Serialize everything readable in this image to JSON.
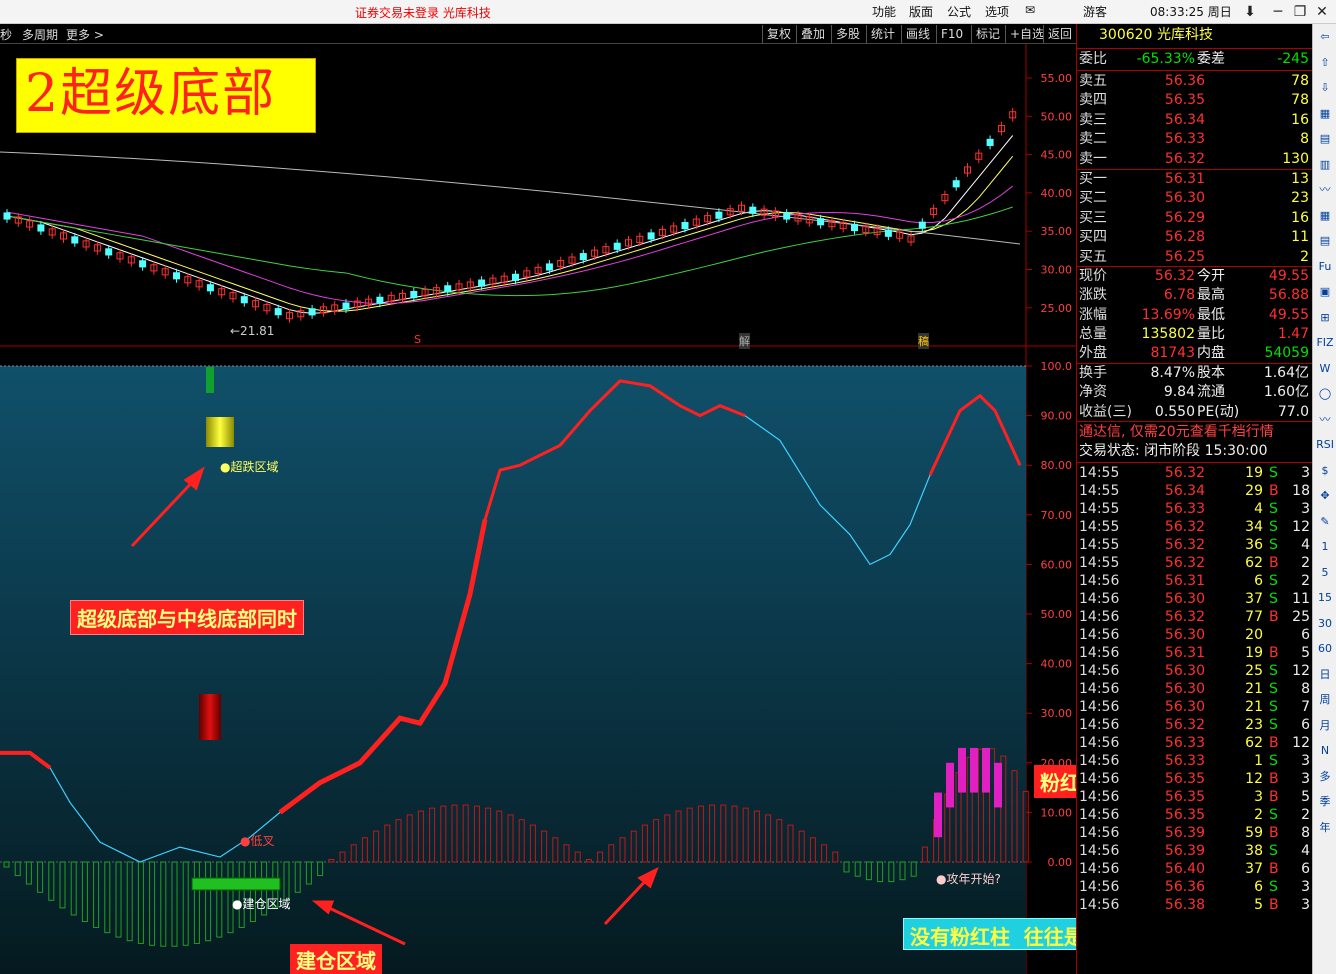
{
  "titlebar": {
    "notice": "证券交易未登录  光库科技",
    "menus": [
      "功能",
      "版面",
      "公式",
      "选项"
    ],
    "user": "游客",
    "time": "08:33:25 周日",
    "win_buttons": [
      "⬇",
      "─",
      "❐",
      "✕"
    ]
  },
  "toolbar": {
    "left_items": [
      "秒",
      "多周期",
      "更多 >"
    ],
    "buttons": [
      "复权",
      "叠加",
      "多股",
      "统计",
      "画线",
      "F10",
      "标记",
      "+自选",
      "返回"
    ]
  },
  "chart_labels": {
    "title_box": "2超级底部",
    "low_price": "←21.81",
    "marker_s": "S",
    "marker_jie": "解",
    "marker_qin": "稿",
    "super_fall_zone": "●超跌区域",
    "bottom_note": "超级底部与中线底部同时",
    "low_cross": "●低叉",
    "build_zone": "●建仓区域",
    "build_zone_big": "建仓区域",
    "pink_note": "粉红柱是攻年线的能量柱",
    "attack_start": "●攻年开始?",
    "no_pink": "没有粉红柱  往往是攻年失败的!"
  },
  "upper_axis": [
    "55.00",
    "50.00",
    "45.00",
    "40.00",
    "35.00",
    "30.00",
    "25.00"
  ],
  "lower_axis": [
    "100.0",
    "90.00",
    "80.00",
    "70.00",
    "60.00",
    "50.00",
    "40.00",
    "30.00",
    "20.00",
    "10.00",
    "0.00"
  ],
  "quote": {
    "code": "300620",
    "name": "光库科技",
    "weibi_label": "委比",
    "weibi": "-65.33%",
    "weicha_label": "委差",
    "weicha": "-245",
    "asks": [
      {
        "l": "卖五",
        "p": "56.36",
        "v": "78"
      },
      {
        "l": "卖四",
        "p": "56.35",
        "v": "78"
      },
      {
        "l": "卖三",
        "p": "56.34",
        "v": "16"
      },
      {
        "l": "卖二",
        "p": "56.33",
        "v": "8"
      },
      {
        "l": "卖一",
        "p": "56.32",
        "v": "130"
      }
    ],
    "bids": [
      {
        "l": "买一",
        "p": "56.31",
        "v": "13"
      },
      {
        "l": "买二",
        "p": "56.30",
        "v": "23"
      },
      {
        "l": "买三",
        "p": "56.29",
        "v": "16"
      },
      {
        "l": "买四",
        "p": "56.28",
        "v": "11"
      },
      {
        "l": "买五",
        "p": "56.25",
        "v": "2"
      }
    ],
    "stats": [
      {
        "a": "现价",
        "b": "56.32",
        "c": "今开",
        "d": "49.55"
      },
      {
        "a": "涨跌",
        "b": "6.78",
        "c": "最高",
        "d": "56.88"
      },
      {
        "a": "涨幅",
        "b": "13.69%",
        "c": "最低",
        "d": "49.55"
      },
      {
        "a": "总量",
        "b": "135802",
        "c": "量比",
        "d": "1.47"
      },
      {
        "a": "外盘",
        "b": "81743",
        "c": "内盘",
        "d": "54059"
      }
    ],
    "stats2": [
      {
        "a": "换手",
        "b": "8.47%",
        "c": "股本",
        "d": "1.64亿"
      },
      {
        "a": "净资",
        "b": "9.84",
        "c": "流通",
        "d": "1.60亿"
      },
      {
        "a": "收益(三)",
        "b": "0.550",
        "c": "PE(动)",
        "d": "77.0"
      }
    ],
    "ad": "通达信, 仅需20元查看千档行情",
    "status": "交易状态: 闭市阶段 15:30:00"
  },
  "ticks": [
    [
      "14:55",
      "56.32",
      "19",
      "S",
      "3"
    ],
    [
      "14:55",
      "56.34",
      "29",
      "B",
      "18"
    ],
    [
      "14:55",
      "56.33",
      "4",
      "S",
      "3"
    ],
    [
      "14:55",
      "56.32",
      "34",
      "S",
      "12"
    ],
    [
      "14:55",
      "56.32",
      "36",
      "S",
      "4"
    ],
    [
      "14:55",
      "56.32",
      "62",
      "B",
      "2"
    ],
    [
      "14:56",
      "56.31",
      "6",
      "S",
      "2"
    ],
    [
      "14:56",
      "56.30",
      "37",
      "S",
      "11"
    ],
    [
      "14:56",
      "56.32",
      "77",
      "B",
      "25"
    ],
    [
      "14:56",
      "56.30",
      "20",
      "",
      "6"
    ],
    [
      "14:56",
      "56.31",
      "19",
      "B",
      "5"
    ],
    [
      "14:56",
      "56.30",
      "25",
      "S",
      "12"
    ],
    [
      "14:56",
      "56.30",
      "21",
      "S",
      "8"
    ],
    [
      "14:56",
      "56.30",
      "21",
      "S",
      "7"
    ],
    [
      "14:56",
      "56.32",
      "23",
      "S",
      "6"
    ],
    [
      "14:56",
      "56.33",
      "62",
      "B",
      "12"
    ],
    [
      "14:56",
      "56.33",
      "1",
      "S",
      "3"
    ],
    [
      "14:56",
      "56.35",
      "12",
      "B",
      "3"
    ],
    [
      "14:56",
      "56.35",
      "3",
      "B",
      "5"
    ],
    [
      "14:56",
      "56.35",
      "2",
      "S",
      "2"
    ],
    [
      "14:56",
      "56.39",
      "59",
      "B",
      "8"
    ],
    [
      "14:56",
      "56.39",
      "38",
      "S",
      "4"
    ],
    [
      "14:56",
      "56.40",
      "37",
      "B",
      "6"
    ],
    [
      "14:56",
      "56.36",
      "6",
      "S",
      "3"
    ],
    [
      "14:56",
      "56.38",
      "5",
      "B",
      "3"
    ]
  ],
  "sidebar": [
    "⇦",
    "⇧",
    "⇩",
    "▦",
    "▤",
    "▥",
    "〰",
    "▦",
    "▤",
    "Fu",
    "▣",
    "⊞",
    "FIZ",
    "W",
    "◯",
    "〰",
    "RSI",
    "$",
    "✥",
    "✎",
    "1",
    "5",
    "15",
    "30",
    "60",
    "日",
    "周",
    "月",
    "N",
    "多",
    "季",
    "年"
  ],
  "colors": {
    "up": "#ff3030",
    "down": "#54ffff",
    "oscillator": "#ff2020",
    "oscillator_thin": "#40d0ff",
    "pink": "#e020c0",
    "green_bar": "#20a020"
  }
}
